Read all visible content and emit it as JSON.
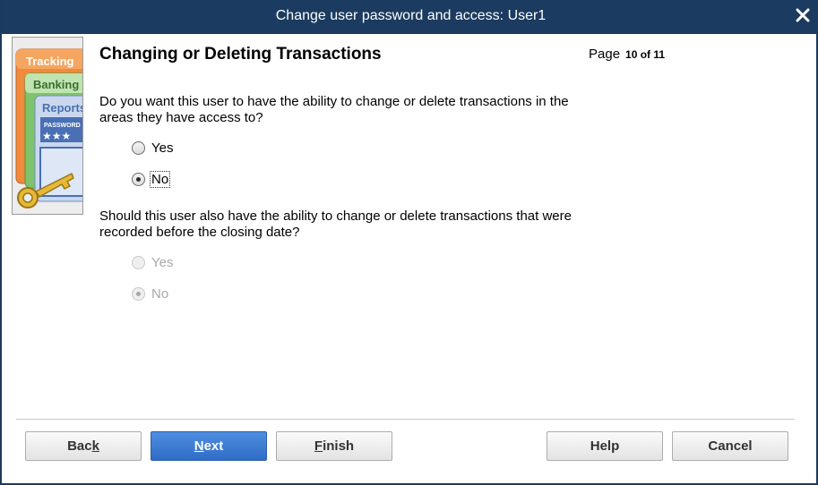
{
  "window": {
    "title": "Change user password and access: User1"
  },
  "art": {
    "card1": "Tracking",
    "card2": "Banking",
    "card3": "Reports",
    "card3_sub": "PASSWORD",
    "card3_stars": "★★★"
  },
  "page": {
    "heading": "Changing or Deleting Transactions",
    "page_label": "Page",
    "page_num": "10 of 11"
  },
  "q1": {
    "text": "Do you want this user to have the ability to change or delete transactions in the areas they have access to?",
    "yes_label": "Yes",
    "no_label": "No",
    "selected": "No"
  },
  "q2": {
    "text": "Should this user also have the ability to change or delete transactions that were recorded before the closing date?",
    "yes_label": "Yes",
    "no_label": "No",
    "selected": "No",
    "disabled": true
  },
  "buttons": {
    "back": {
      "pre": "Bac",
      "ul": "k",
      "post": ""
    },
    "next": {
      "pre": "",
      "ul": "N",
      "post": "ext"
    },
    "finish": {
      "pre": "",
      "ul": "F",
      "post": "inish"
    },
    "help": "Help",
    "cancel": "Cancel"
  },
  "colors": {
    "titlebar": "#1b3b60",
    "primary": "#2f6cc7"
  }
}
